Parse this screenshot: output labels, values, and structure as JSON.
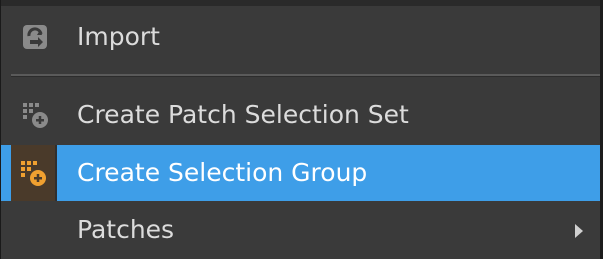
{
  "menu": {
    "items": [
      {
        "label": "Import",
        "icon": "import-icon"
      },
      {
        "label": "Create Patch Selection Set",
        "icon": "patch-set-add-icon"
      },
      {
        "label": "Create Selection Group",
        "icon": "selection-group-add-icon",
        "highlighted": true
      },
      {
        "label": "Patches",
        "has_submenu": true
      }
    ]
  },
  "colors": {
    "background": "#3a3a3a",
    "highlight": "#3e9ee8",
    "text": "#dcdcdc",
    "accent_orange": "#f0a030"
  }
}
